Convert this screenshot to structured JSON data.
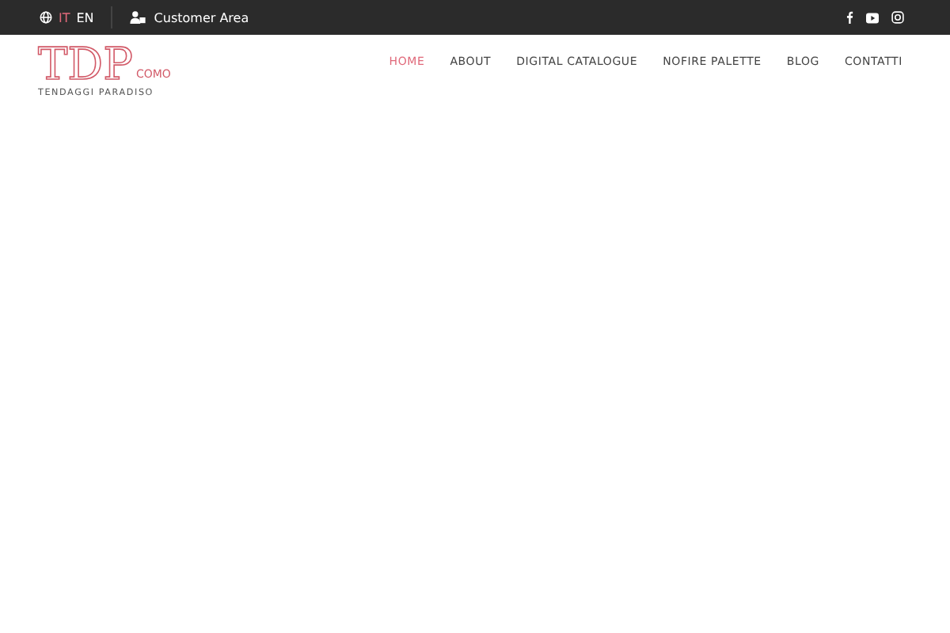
{
  "top_bar": {
    "languages": [
      {
        "label": "IT",
        "selected": true
      },
      {
        "label": "EN",
        "selected": false
      }
    ],
    "customer_area": "Customer Area"
  },
  "logo": {
    "mark": "TDP",
    "city": "COMO",
    "tagline": "TENDAGGI PARADISO"
  },
  "nav": [
    {
      "label": "HOME",
      "selected": true
    },
    {
      "label": "ABOUT",
      "selected": false
    },
    {
      "label": "DIGITAL CATALOGUE",
      "selected": false
    },
    {
      "label": "NOFIRE PALETTE",
      "selected": false
    },
    {
      "label": "BLOG",
      "selected": false
    },
    {
      "label": "CONTATTI",
      "selected": false
    }
  ]
}
